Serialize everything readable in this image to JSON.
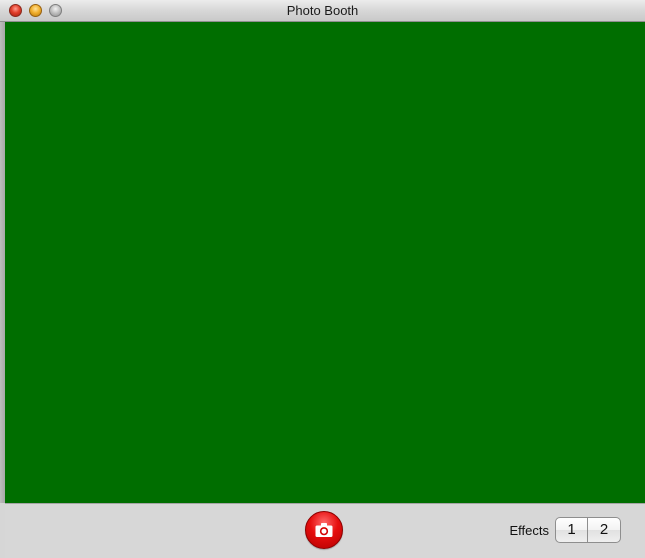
{
  "window": {
    "title": "Photo Booth"
  },
  "preview": {
    "background_color": "#006e00"
  },
  "toolbar": {
    "shutter_icon": "camera-icon",
    "effects_label": "Effects",
    "effects_pages": [
      "1",
      "2"
    ]
  }
}
